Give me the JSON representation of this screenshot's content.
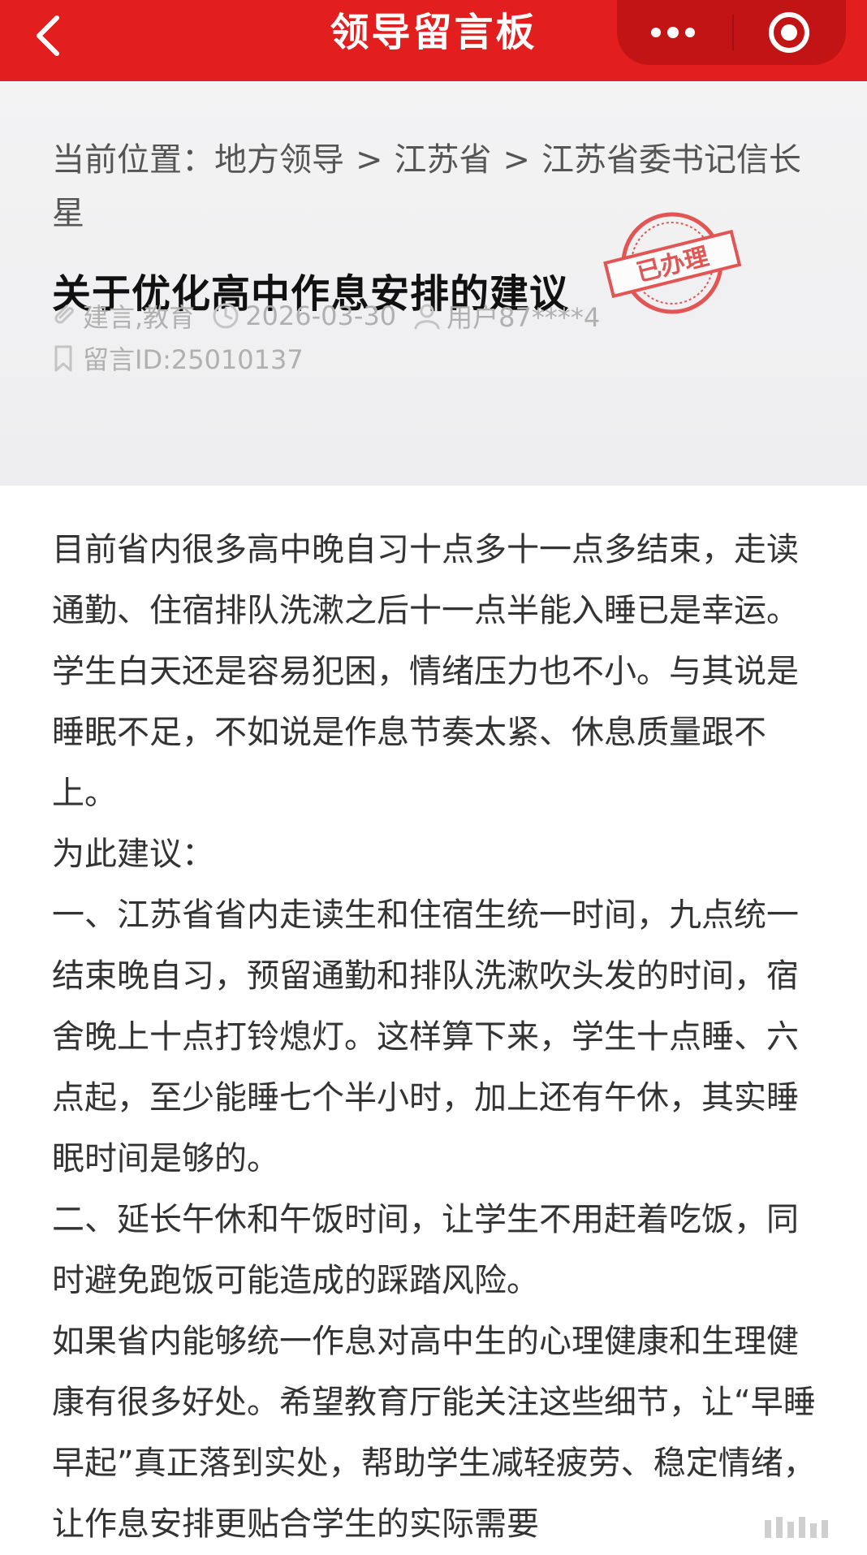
{
  "nav": {
    "title": "领导留言板"
  },
  "breadcrumb": {
    "prefix": "当前位置：",
    "items": [
      "地方领导",
      "江苏省",
      "江苏省委书记信长星"
    ],
    "separator": ">"
  },
  "post": {
    "title": "关于优化高中作息安排的建议",
    "stamp_text": "已办理",
    "tags": "建言,教育",
    "date": "2026-03-30",
    "user": "用户87****4",
    "message_id": "留言ID:25010137"
  },
  "content": {
    "paragraphs": [
      "目前省内很多高中晚自习十点多十一点多结束，走读通勤、住宿排队洗漱之后十一点半能入睡已是幸运。学生白天还是容易犯困，情绪压力也不小。与其说是睡眠不足，不如说是作息节奏太紧、休息质量跟不上。",
      "为此建议：",
      "一、江苏省省内走读生和住宿生统一时间，九点统一结束晚自习，预留通勤和排队洗漱吹头发的时间，宿舍晚上十点打铃熄灯。这样算下来，学生十点睡、六点起，至少能睡七个半小时，加上还有午休，其实睡眠时间是够的。",
      "二、延长午休和午饭时间，让学生不用赶着吃饭，同时避免跑饭可能造成的踩踏风险。",
      "如果省内能够统一作息对高中生的心理健康和生理健康有很多好处。希望教育厅能关注这些细节，让“早睡早起”真正落到实处，帮助学生减轻疲劳、稳定情绪，让作息安排更贴合学生的实际需要"
    ]
  },
  "colors": {
    "brand_red": "#e21e1e",
    "capsule_red": "#c21414",
    "header_bg": "#f3f3f4",
    "meta_gray": "#b0b0b0",
    "stamp_red": "#e03a3a"
  },
  "icons": {
    "back": "chevron-left-icon",
    "more": "more-dots-icon",
    "record": "record-icon",
    "tag": "tag-icon",
    "clock": "clock-icon",
    "user": "user-icon",
    "bookmark": "bookmark-icon"
  }
}
